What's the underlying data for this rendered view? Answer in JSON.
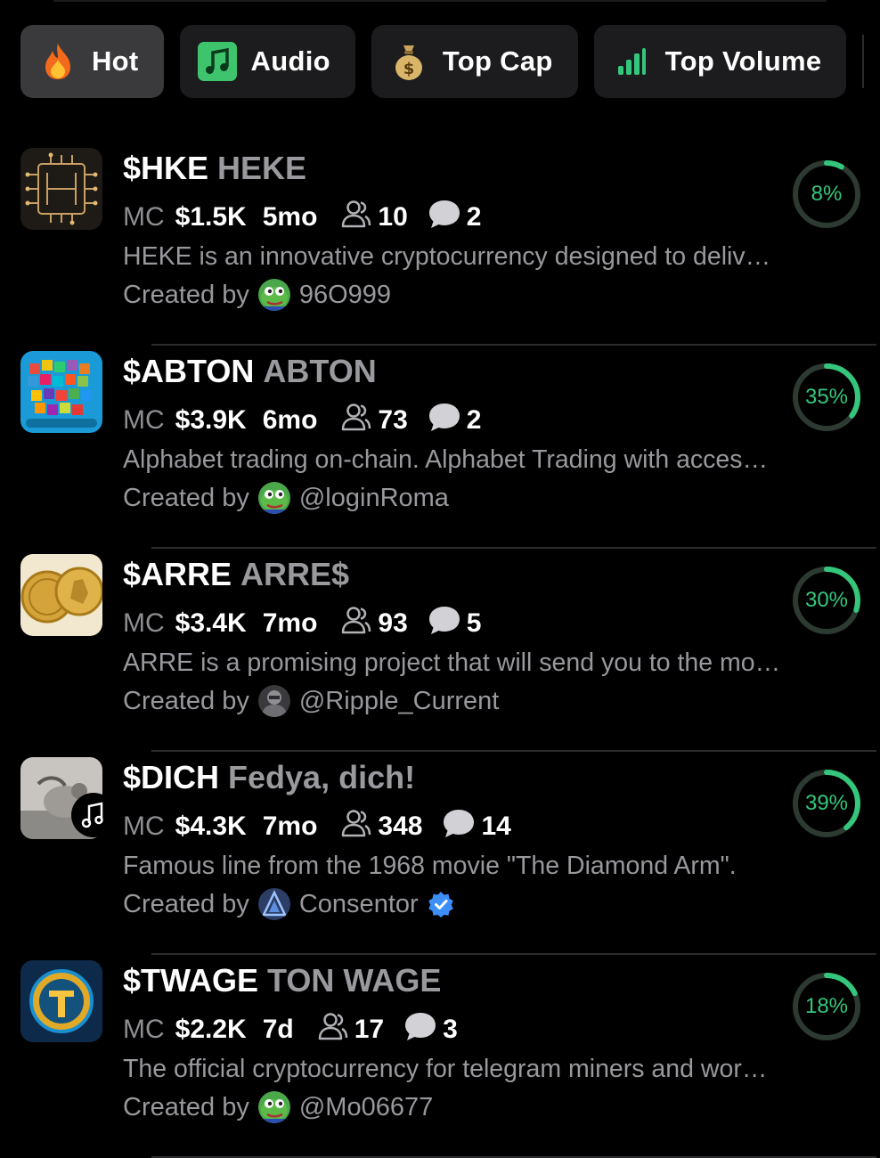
{
  "tabs": [
    {
      "label": "Hot",
      "icon": "fire-icon",
      "active": true
    },
    {
      "label": "Audio",
      "icon": "music-note-icon",
      "active": false
    },
    {
      "label": "Top Cap",
      "icon": "money-bag-icon",
      "active": false
    },
    {
      "label": "Top Volume",
      "icon": "bar-chart-icon",
      "active": false
    }
  ],
  "colors": {
    "accent_green": "#34c77b",
    "progress_track": "#2c3a32",
    "verified_blue": "#3d8ef7"
  },
  "labels": {
    "mc": "MC",
    "created_by": "Created by"
  },
  "tokens": [
    {
      "ticker": "$HKE",
      "name": "HEKE",
      "mc": "$1.5K",
      "age": "5mo",
      "holders": "10",
      "comments": "2",
      "description": "HEKE is an innovative cryptocurrency designed to deliv…",
      "creator": "96O999",
      "progress": 8,
      "progress_label": "8%",
      "audio": false,
      "verified": false
    },
    {
      "ticker": "$ABTON",
      "name": "ABTON",
      "mc": "$3.9K",
      "age": "6mo",
      "holders": "73",
      "comments": "2",
      "description": "Alphabet trading on-chain. Alphabet Trading with acces…",
      "creator": "@loginRoma",
      "progress": 35,
      "progress_label": "35%",
      "audio": false,
      "verified": false
    },
    {
      "ticker": "$ARRE",
      "name": "ARRE$",
      "mc": "$3.4K",
      "age": "7mo",
      "holders": "93",
      "comments": "5",
      "description": "ARRE is a promising project that will send you to the mo…",
      "creator": "@Ripple_Current",
      "progress": 30,
      "progress_label": "30%",
      "audio": false,
      "verified": false
    },
    {
      "ticker": "$DICH",
      "name": "Fedya, dich!",
      "mc": "$4.3K",
      "age": "7mo",
      "holders": "348",
      "comments": "14",
      "description": "Famous line from the 1968 movie \"The Diamond Arm\".",
      "creator": "Consentor",
      "progress": 39,
      "progress_label": "39%",
      "audio": true,
      "verified": true
    },
    {
      "ticker": "$TWAGE",
      "name": "TON WAGE",
      "mc": "$2.2K",
      "age": "7d",
      "holders": "17",
      "comments": "3",
      "description": "The official cryptocurrency for telegram miners and wor…",
      "creator": "@Mo06677",
      "progress": 18,
      "progress_label": "18%",
      "audio": false,
      "verified": false
    }
  ]
}
